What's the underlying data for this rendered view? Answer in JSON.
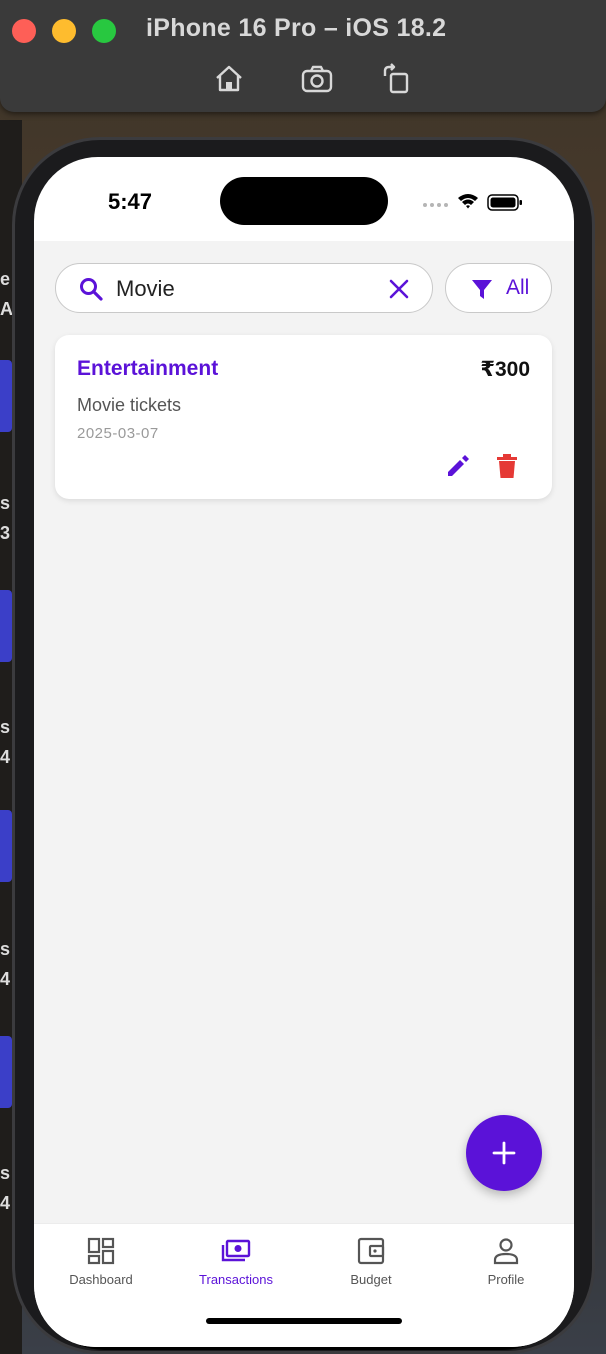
{
  "simulator": {
    "title": "iPhone 16 Pro – iOS 18.2",
    "tools": [
      "home-icon",
      "screenshot-icon",
      "rotate-icon"
    ]
  },
  "status_bar": {
    "time": "5:47"
  },
  "search": {
    "value": "Movie",
    "placeholder": "Search"
  },
  "filter": {
    "label": "All"
  },
  "transactions": [
    {
      "category": "Entertainment",
      "amount": "₹300",
      "description": "Movie tickets",
      "date": "2025-03-07"
    }
  ],
  "nav": {
    "items": [
      {
        "label": "Dashboard",
        "icon": "dashboard-icon"
      },
      {
        "label": "Transactions",
        "icon": "transactions-icon"
      },
      {
        "label": "Budget",
        "icon": "wallet-icon"
      },
      {
        "label": "Profile",
        "icon": "profile-icon"
      }
    ],
    "active": "Transactions"
  },
  "colors": {
    "accent": "#5b12d8",
    "delete": "#e53935",
    "background": "#f3f3f3"
  }
}
